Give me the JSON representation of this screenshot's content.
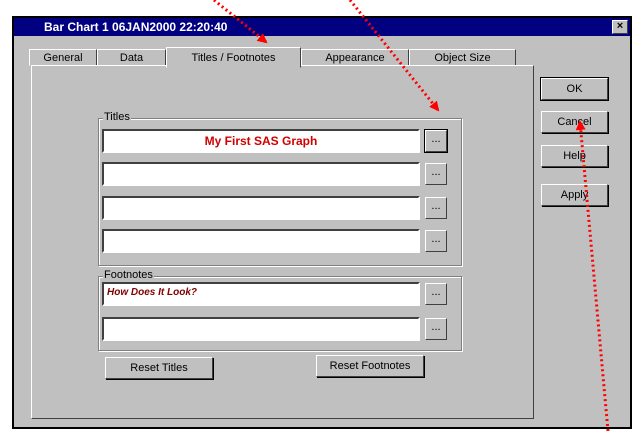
{
  "window": {
    "title": "Bar Chart 1 06JAN2000 22:20:40",
    "close_symbol": "×"
  },
  "tabs": [
    {
      "label": "General"
    },
    {
      "label": "Data"
    },
    {
      "label": "Titles / Footnotes"
    },
    {
      "label": "Appearance"
    },
    {
      "label": "Object Size"
    }
  ],
  "titles_group": {
    "label": "Titles",
    "values": [
      "My First SAS Graph",
      "",
      "",
      ""
    ],
    "browse_label": "..."
  },
  "footnotes_group": {
    "label": "Footnotes",
    "values": [
      "How Does It Look?",
      ""
    ],
    "browse_label": "..."
  },
  "buttons": {
    "reset_titles": "Reset Titles",
    "reset_footnotes": "Reset Footnotes",
    "ok": "OK",
    "cancel": "Cancel",
    "help": "Help",
    "apply": "Apply"
  },
  "annotation_color": "#ff0000"
}
